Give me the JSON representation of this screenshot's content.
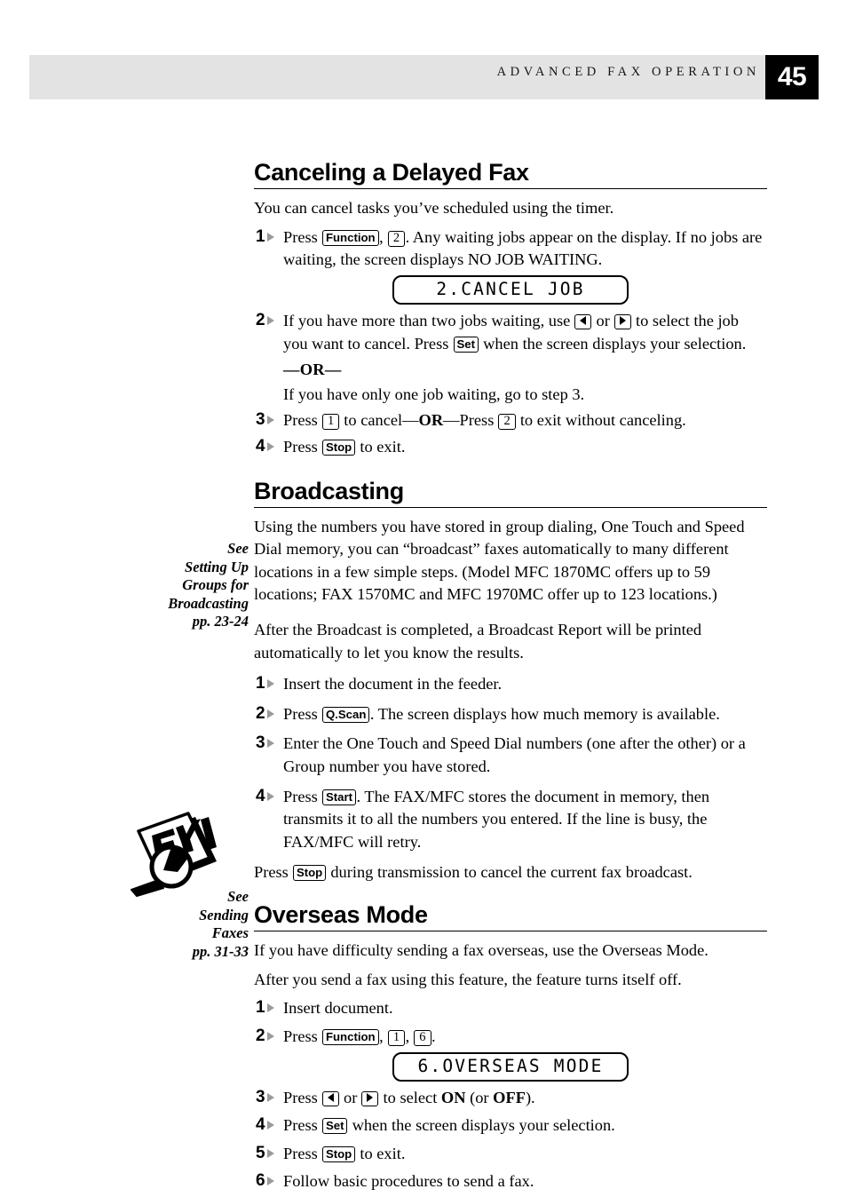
{
  "header": {
    "running_title": "ADVANCED FAX OPERATION",
    "page_number": "45",
    "band_color": "#e3e3e3",
    "page_box_color": "#000000"
  },
  "sections": [
    {
      "id": "canceling-a-delayed-fax",
      "heading": "Canceling a Delayed Fax",
      "intro": "You can cancel tasks you’ve scheduled using the timer.",
      "steps": [
        {
          "number": "1",
          "text_parts": {
            "a": "Press ",
            "key1": "Function",
            "b": ", ",
            "key2": "2",
            "c": ". Any waiting jobs appear on the display. If no jobs are waiting, the screen displays NO JOB WAITING."
          }
        },
        {
          "number": "2",
          "text_parts": {
            "a": "If you have more than two jobs waiting, use ",
            "arrow_left": "left-arrow",
            "b": " or ",
            "arrow_right": "right-arrow",
            "c": " to select the job you want to cancel. Press ",
            "key1": "Set",
            "d": " when the screen displays your selection."
          },
          "or_divider": "—OR—",
          "alternate": "If you have only one job waiting, go to step 3."
        },
        {
          "number": "3",
          "text_parts": {
            "a": "Press ",
            "key1": "1",
            "b": " to cancel—",
            "or": "OR",
            "c": "—Press ",
            "key2": "2",
            "d": " to exit without canceling."
          }
        },
        {
          "number": "4",
          "text_parts": {
            "a": "Press ",
            "key1": "Stop",
            "b": " to exit."
          }
        }
      ],
      "lcd": "2.CANCEL JOB"
    },
    {
      "id": "broadcasting",
      "heading": "Broadcasting",
      "margin_note": {
        "lines": [
          "See",
          "Setting Up",
          "Groups for",
          "Broadcasting",
          "pp. 23-24"
        ]
      },
      "paragraphs": [
        "Using the numbers you have stored in group dialing, One Touch and Speed Dial memory, you can “broadcast” faxes automatically to many different locations in a few simple steps.   (Model MFC 1870MC offers up to 59 locations; FAX 1570MC and MFC 1970MC offer up to 123 locations.)",
        "After the Broadcast is completed, a Broadcast Report will be printed automatically to let you know the results."
      ],
      "steps": [
        {
          "number": "1",
          "text_parts": {
            "a": "Insert the document in the feeder."
          }
        },
        {
          "number": "2",
          "text_parts": {
            "a": "Press ",
            "key1": "Q.Scan",
            "b": ".   The screen displays how much memory is available."
          }
        },
        {
          "number": "3",
          "text_parts": {
            "a": "Enter the One Touch and Speed Dial numbers (one after the other) or a Group number you have stored."
          }
        },
        {
          "number": "4",
          "text_parts": {
            "a": "Press ",
            "key1": "Start",
            "b": ".  The FAX/MFC stores the document in memory, then transmits it to all the numbers you entered.  If the line is busy, the FAX/MFC will retry."
          }
        }
      ],
      "closing_parts": {
        "a": "Press ",
        "key1": "Stop",
        "b": " during transmission to cancel the current fax broadcast."
      }
    },
    {
      "id": "overseas-mode",
      "heading": "Overseas Mode",
      "margin_note": {
        "icon": "fyi-magnifier-icon",
        "icon_label": "FYI",
        "lines": [
          "See",
          "Sending",
          "Faxes",
          "pp. 31-33"
        ]
      },
      "paragraphs": [
        "If you have difficulty sending a fax overseas, use the Overseas Mode.",
        "After you send a fax using this feature, the feature turns itself off."
      ],
      "steps": [
        {
          "number": "1",
          "text_parts": {
            "a": "Insert document."
          }
        },
        {
          "number": "2",
          "text_parts": {
            "a": "Press ",
            "key1": "Function",
            "b": ", ",
            "key2": "1",
            "c": ", ",
            "key3": "6",
            "d": "."
          }
        },
        {
          "number": "3",
          "text_parts": {
            "a": "Press ",
            "arrow_left": "left-arrow",
            "b": " or ",
            "arrow_right": "right-arrow",
            "c": " to select ",
            "on": "ON",
            "d": " (or ",
            "off": "OFF",
            "e": ")."
          }
        },
        {
          "number": "4",
          "text_parts": {
            "a": "Press ",
            "key1": "Set",
            "b": " when the screen displays your selection."
          }
        },
        {
          "number": "5",
          "text_parts": {
            "a": "Press ",
            "key1": "Stop",
            "b": " to exit."
          }
        },
        {
          "number": "6",
          "text_parts": {
            "a": "Follow basic procedures to send a fax."
          }
        }
      ],
      "lcd": "6.OVERSEAS MODE"
    }
  ]
}
